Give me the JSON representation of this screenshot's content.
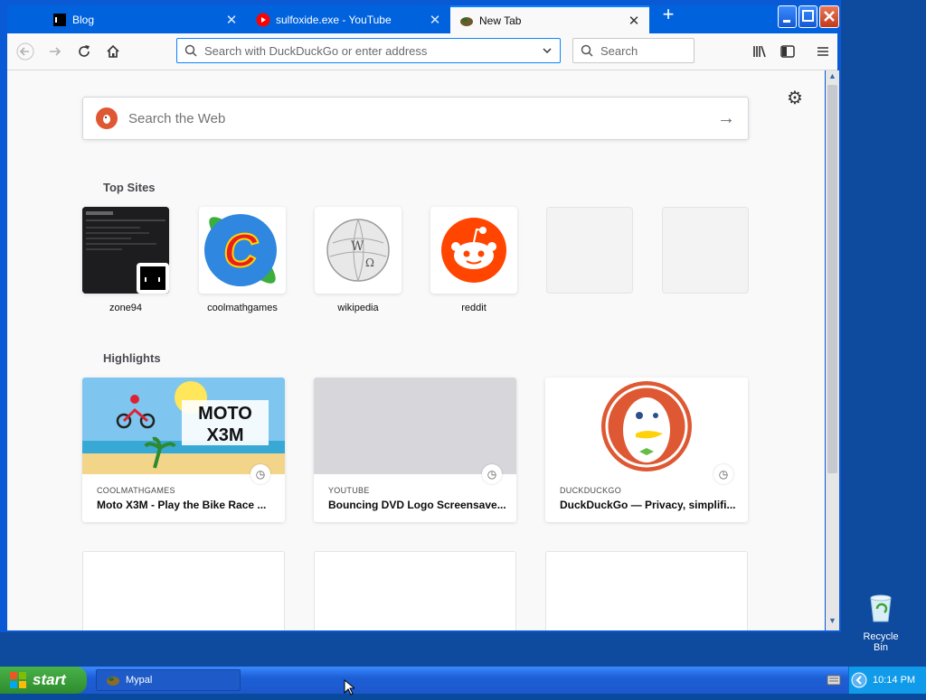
{
  "browser": {
    "tabs": [
      {
        "label": "Blog",
        "icon": "terminal-icon",
        "active": false
      },
      {
        "label": "sulfoxide.exe - YouTube",
        "icon": "youtube-icon",
        "active": false
      },
      {
        "label": "New Tab",
        "icon": "firefox-icon",
        "active": true
      }
    ],
    "url_placeholder": "Search with DuckDuckGo or enter address",
    "search_placeholder": "Search"
  },
  "newtab": {
    "search_placeholder": "Search the Web",
    "top_sites_title": "Top Sites",
    "top_sites": [
      {
        "name": "zone94"
      },
      {
        "name": "coolmathgames"
      },
      {
        "name": "wikipedia"
      },
      {
        "name": "reddit"
      },
      {
        "name": ""
      },
      {
        "name": ""
      }
    ],
    "highlights_title": "Highlights",
    "highlights": [
      {
        "source": "COOLMATHGAMES",
        "title": "Moto X3M - Play the Bike Race ..."
      },
      {
        "source": "YOUTUBE",
        "title": "Bouncing DVD Logo Screensave..."
      },
      {
        "source": "DUCKDUCKGO",
        "title": "DuckDuckGo — Privacy, simplifi..."
      }
    ]
  },
  "desktop": {
    "recycle_bin_label": "Recycle Bin"
  },
  "taskbar": {
    "start_label": "start",
    "task_label": "Mypal",
    "clock": "10:14 PM"
  },
  "colors": {
    "accent": "#0a84ff",
    "xp_blue": "#0063dd",
    "start_green": "#2e8b2e",
    "ddg_orange": "#de5833",
    "reddit_orange": "#ff4500"
  }
}
